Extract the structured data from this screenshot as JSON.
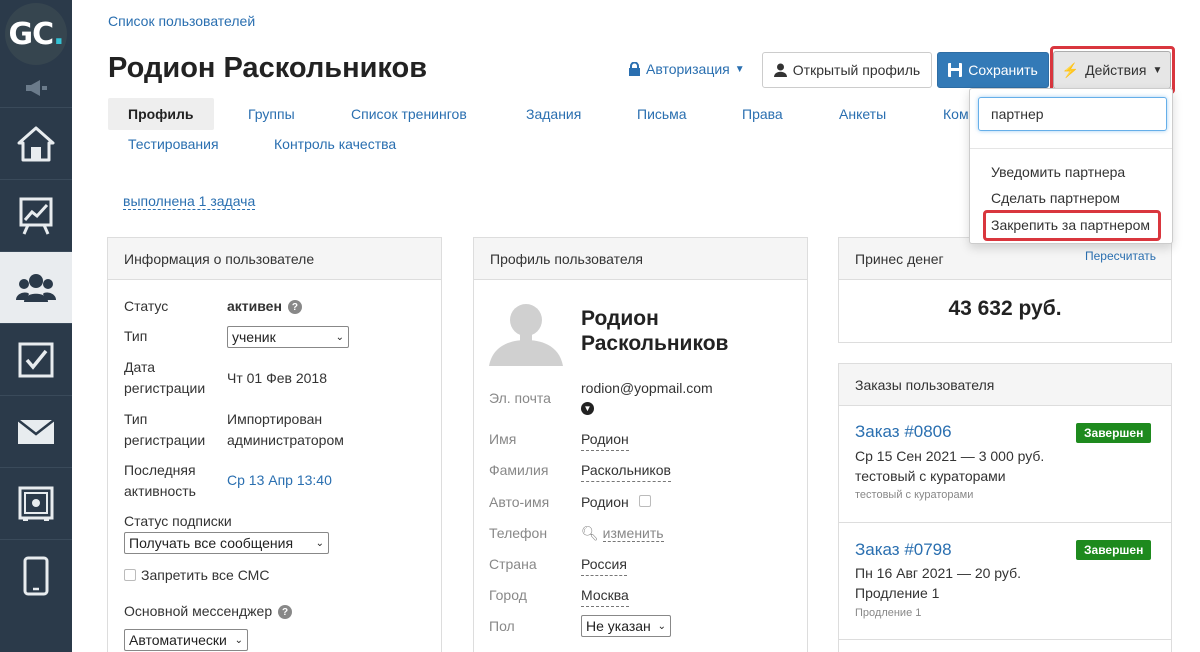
{
  "logo": {
    "text": "GC",
    "dot": "."
  },
  "breadcrumb": "Список пользователей",
  "title": "Родион Раскольников",
  "header": {
    "auth_label": "Авторизация",
    "open_profile_label": "Открытый профиль",
    "save_label": "Сохранить",
    "actions_label": "Действия"
  },
  "tabs": [
    "Профиль",
    "Группы",
    "Список тренингов",
    "Задания",
    "Письма",
    "Права",
    "Анкеты",
    "Ком",
    "Тестирования",
    "Контроль качества"
  ],
  "tasks_link": "выполнена 1 задача",
  "user_info": {
    "title": "Информация о пользователе",
    "status_label": "Статус",
    "status_value": "активен",
    "type_label": "Тип",
    "type_value": "ученик",
    "reg_date_label_1": "Дата",
    "reg_date_label_2": "регистрации",
    "reg_date_value": "Чт 01 Фев 2018",
    "reg_type_label_1": "Тип",
    "reg_type_label_2": "регистрации",
    "reg_type_value_1": "Импортирован",
    "reg_type_value_2": "администратором",
    "last_activity_label_1": "Последняя",
    "last_activity_label_2": "активность",
    "last_activity_value": "Ср 13 Апр 13:40",
    "subscription_label": "Статус подписки",
    "subscription_value": "Получать все сообщения",
    "sms_label": "Запретить все СМС",
    "messenger_label": "Основной мессенджер",
    "messenger_value": "Автоматически"
  },
  "profile": {
    "title": "Профиль пользователя",
    "name_line1": "Родион",
    "name_line2": "Раскольников",
    "email_label": "Эл. почта",
    "email_value": "rodion@yopmail.com",
    "first_name_label": "Имя",
    "first_name_value": "Родион",
    "last_name_label": "Фамилия",
    "last_name_value": "Раскольников",
    "auto_name_label": "Авто-имя",
    "auto_name_value": "Родион",
    "phone_label": "Телефон",
    "phone_value": "изменить",
    "country_label": "Страна",
    "country_value": "Россия",
    "city_label": "Город",
    "city_value": "Москва",
    "gender_label": "Пол",
    "gender_value": "Не указан"
  },
  "money": {
    "title": "Принес денег",
    "recalc": "Пересчитать",
    "amount": "43 632 руб."
  },
  "orders": {
    "title": "Заказы пользователя",
    "items": [
      {
        "number": "Заказ #0806",
        "badge": "Завершен",
        "line1": "Ср 15 Сен 2021 — 3 000 руб.",
        "line2": "тестовый с кураторами",
        "line3": "тестовый с кураторами"
      },
      {
        "number": "Заказ #0798",
        "badge": "Завершен",
        "line1": "Пн 16 Авг 2021 — 20 руб.",
        "line2": "Продление 1",
        "line3": "Продление 1"
      }
    ]
  },
  "dropdown": {
    "search_value": "партнер",
    "items": [
      "Уведомить партнера",
      "Сделать партнером",
      "Закрепить за партнером"
    ]
  },
  "colors": {
    "sidebar": "#2b3a4a",
    "link": "#2a6fb0",
    "primary": "#337ab7",
    "success": "#1e8a1e",
    "highlight": "#d9363e"
  }
}
